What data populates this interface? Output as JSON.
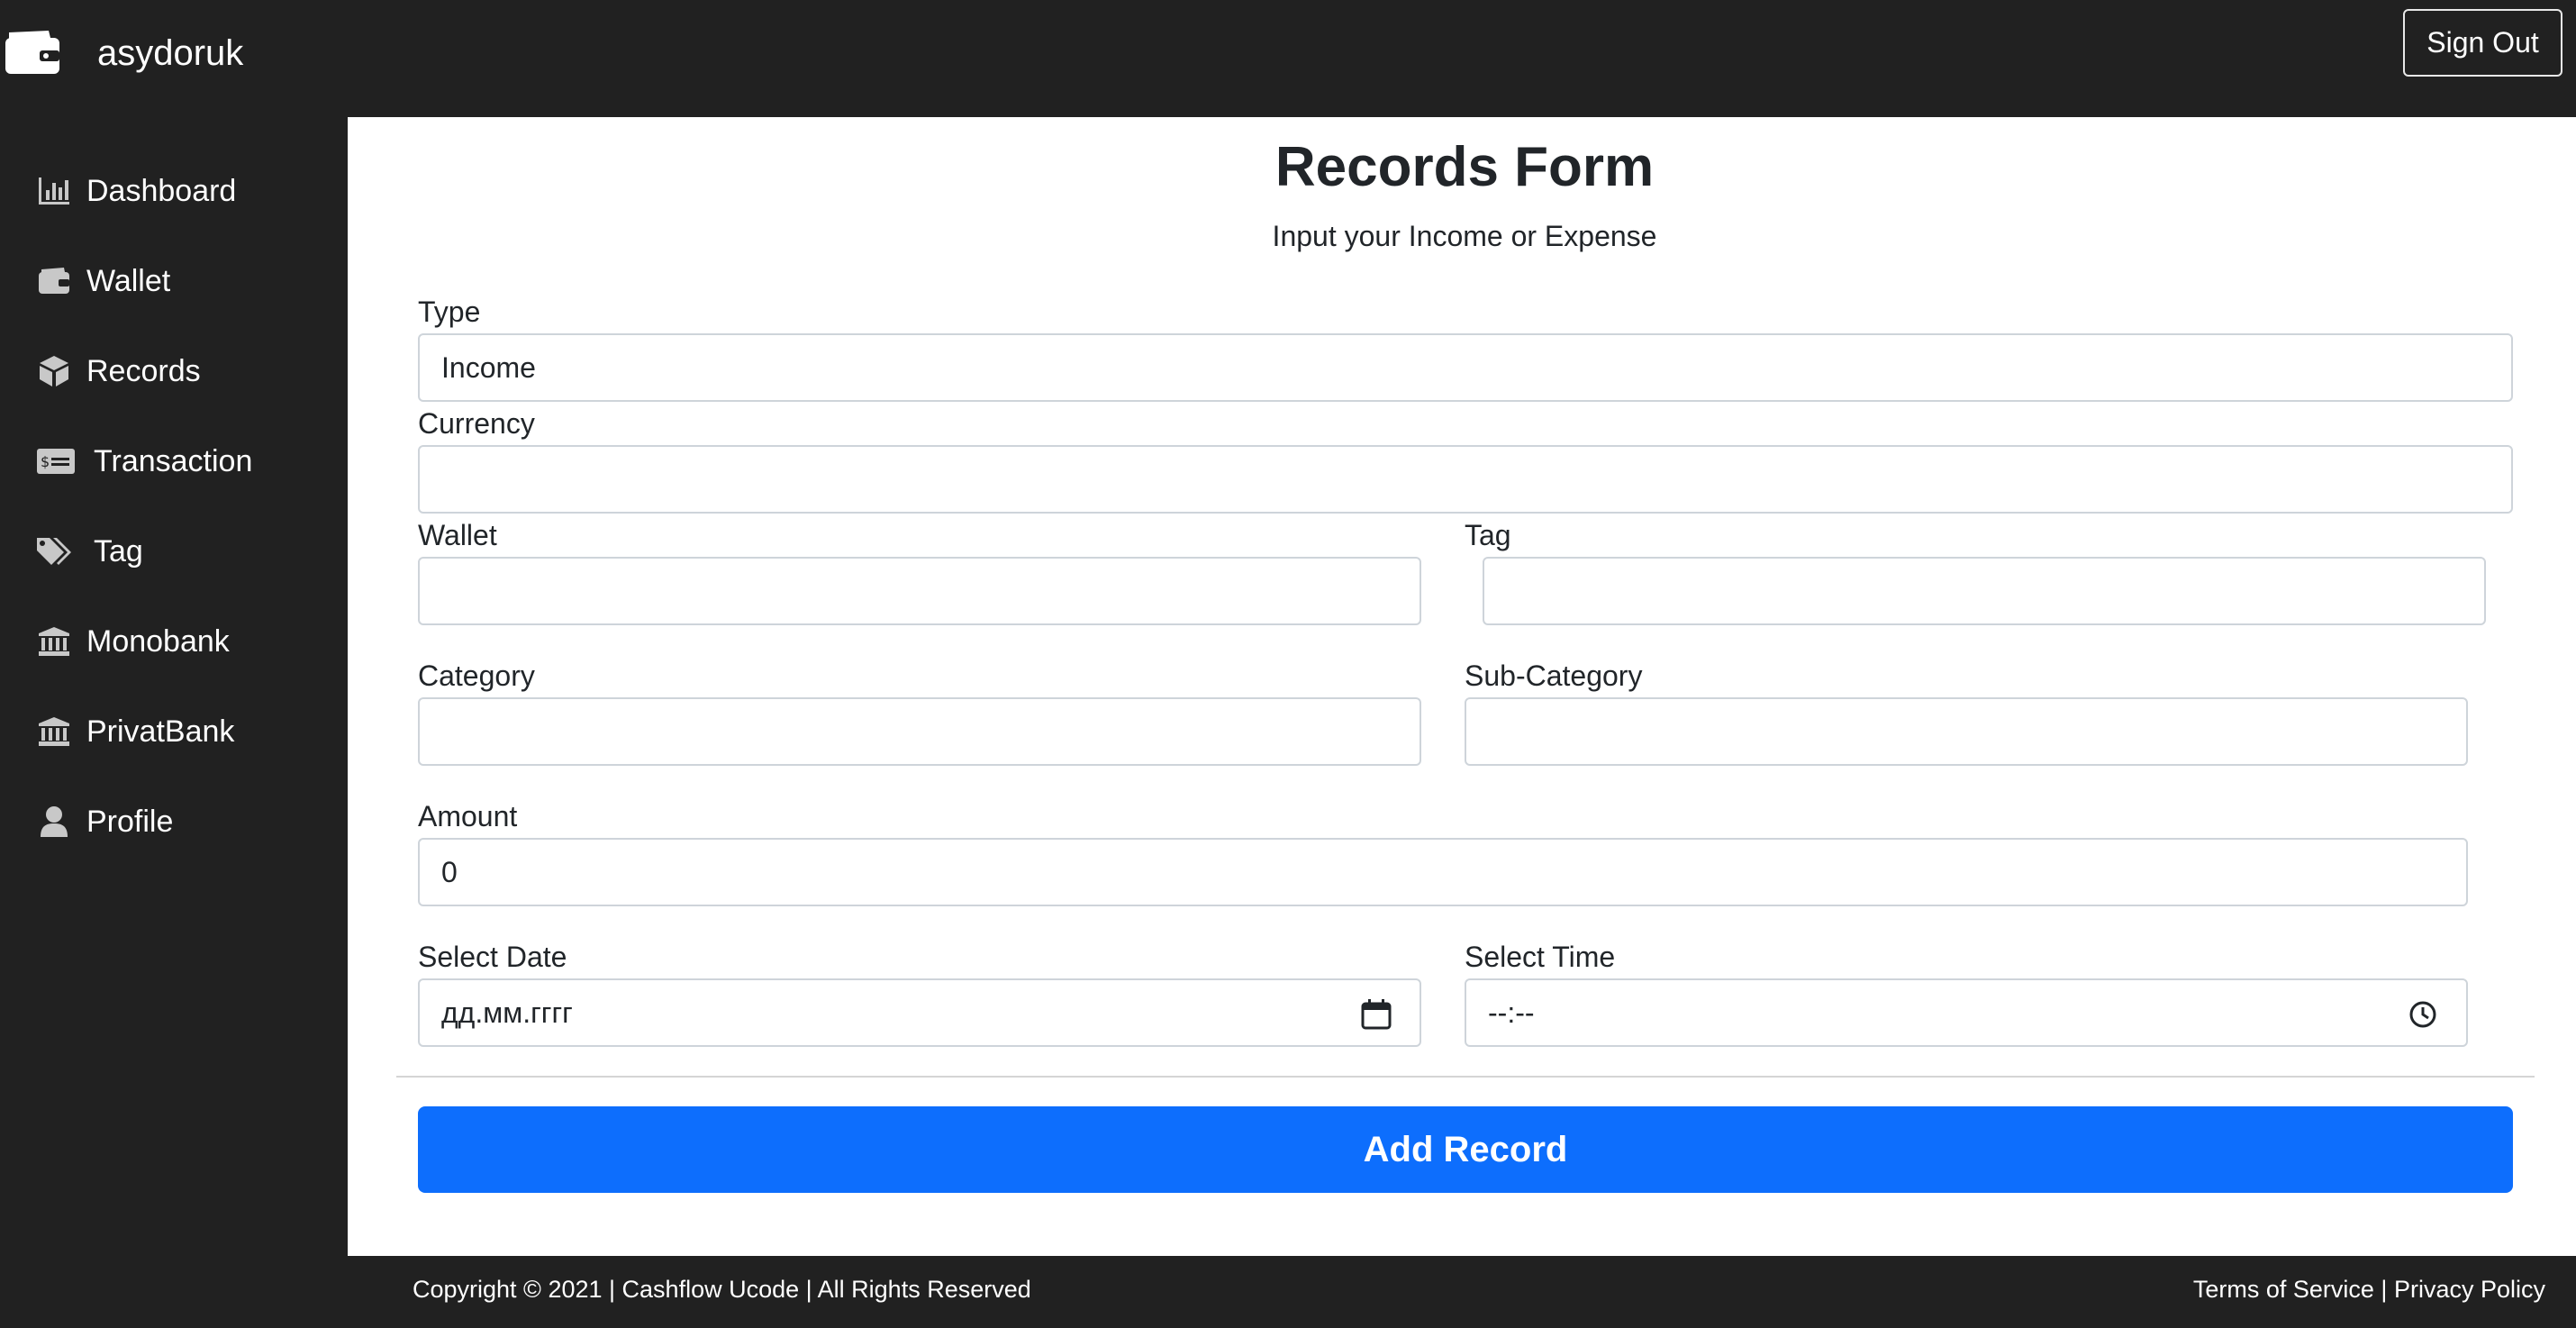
{
  "app": {
    "brand_name": "asydoruk"
  },
  "header": {
    "signout_label": "Sign Out"
  },
  "sidebar": {
    "items": [
      {
        "label": "Dashboard",
        "icon": "chart-bar-icon"
      },
      {
        "label": "Wallet",
        "icon": "wallet-icon"
      },
      {
        "label": "Records",
        "icon": "box-icon"
      },
      {
        "label": "Transaction",
        "icon": "money-check-icon"
      },
      {
        "label": "Tag",
        "icon": "tags-icon"
      },
      {
        "label": "Monobank",
        "icon": "bank-icon"
      },
      {
        "label": "PrivatBank",
        "icon": "bank-icon"
      },
      {
        "label": "Profile",
        "icon": "user-icon"
      }
    ]
  },
  "form": {
    "title": "Records Form",
    "subtitle": "Input your Income or Expense",
    "type": {
      "label": "Type",
      "value": "Income"
    },
    "currency": {
      "label": "Currency",
      "value": ""
    },
    "wallet": {
      "label": "Wallet",
      "value": ""
    },
    "tag": {
      "label": "Tag",
      "value": ""
    },
    "category": {
      "label": "Category",
      "value": ""
    },
    "subcategory": {
      "label": "Sub-Category",
      "value": ""
    },
    "amount": {
      "label": "Amount",
      "value": "0"
    },
    "date": {
      "label": "Select Date",
      "placeholder": "дд.мм.гггг"
    },
    "time": {
      "label": "Select Time",
      "placeholder": "--:--"
    },
    "submit_label": "Add Record"
  },
  "footer": {
    "copyright": "Copyright © 2021 | Cashflow Ucode | All Rights Reserved",
    "terms": "Terms of Service",
    "separator": "|",
    "privacy": "Privacy Policy"
  },
  "colors": {
    "background_dark": "#212121",
    "primary_button": "#0d6efd",
    "content_bg": "#ffffff",
    "sidebar_icon": "#c8c8c8"
  }
}
